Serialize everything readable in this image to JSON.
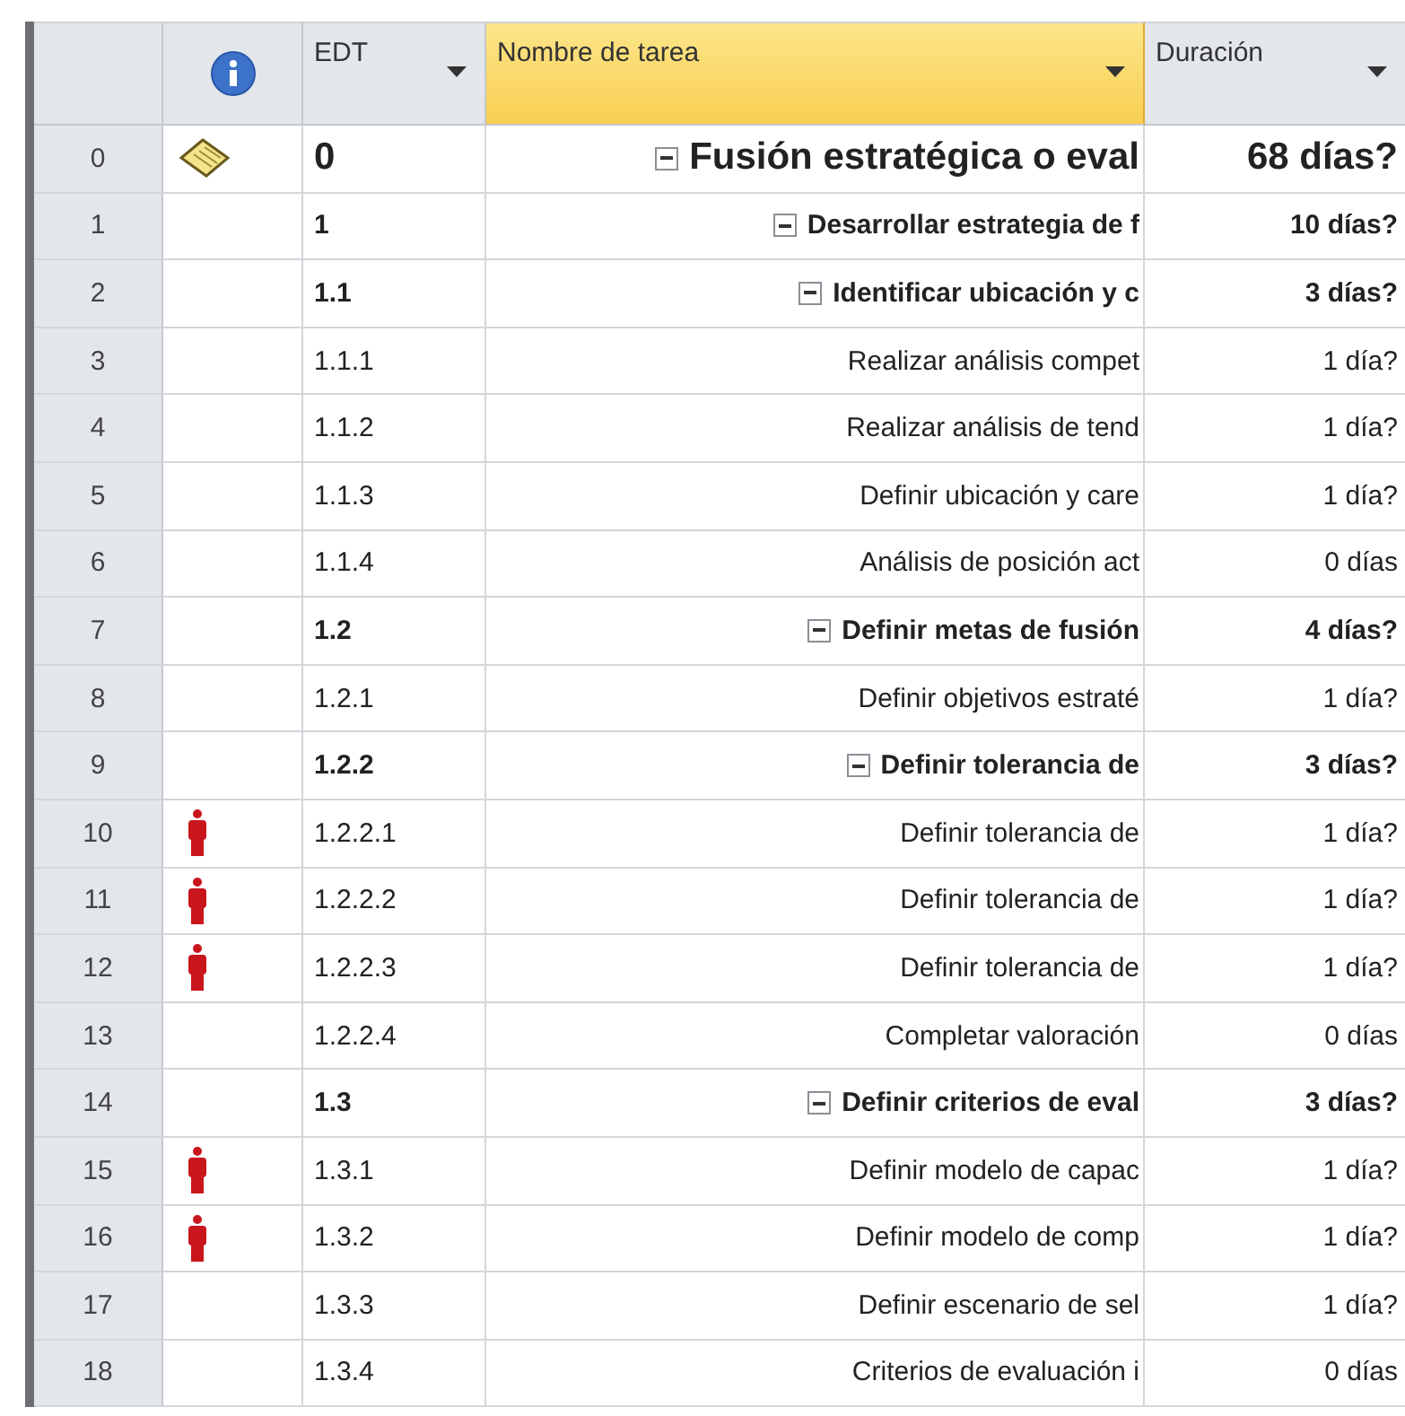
{
  "columns": [
    {
      "label": "EDT",
      "selected": false
    },
    {
      "label": "Nombre de tarea",
      "selected": true
    },
    {
      "label": "Duración",
      "selected": false
    }
  ],
  "tasks": [
    {
      "id": "0",
      "wbs": "0",
      "name": "Fusión estratégica o eval",
      "duration": "68 días?",
      "kind": "note",
      "expanded": true,
      "children": [
        {
          "id": "1",
          "wbs": "1",
          "name": "Desarrollar estrategia de f",
          "duration": "10 días?",
          "expanded": true,
          "children": [
            {
              "id": "2",
              "wbs": "1.1",
              "name": "Identificar ubicación y c",
              "duration": "3 días?",
              "expanded": true,
              "children": [
                {
                  "id": "3",
                  "wbs": "1.1.1",
                  "name": "Realizar análisis compet",
                  "duration": "1 día?"
                },
                {
                  "id": "4",
                  "wbs": "1.1.2",
                  "name": "Realizar análisis de tend",
                  "duration": "1 día?"
                },
                {
                  "id": "5",
                  "wbs": "1.1.3",
                  "name": "Definir ubicación y care",
                  "duration": "1 día?"
                },
                {
                  "id": "6",
                  "wbs": "1.1.4",
                  "name": "Análisis de posición act",
                  "duration": "0 días"
                }
              ]
            },
            {
              "id": "7",
              "wbs": "1.2",
              "name": "Definir metas de fusión",
              "duration": "4 días?",
              "expanded": true,
              "children": [
                {
                  "id": "8",
                  "wbs": "1.2.1",
                  "name": "Definir objetivos estraté",
                  "duration": "1 día?"
                },
                {
                  "id": "9",
                  "wbs": "1.2.2",
                  "name": "Definir tolerancia de",
                  "duration": "3 días?",
                  "expanded": true,
                  "children": [
                    {
                      "id": "10",
                      "wbs": "1.2.2.1",
                      "name": "Definir tolerancia de",
                      "duration": "1 día?",
                      "kind": "person"
                    },
                    {
                      "id": "11",
                      "wbs": "1.2.2.2",
                      "name": "Definir tolerancia de",
                      "duration": "1 día?",
                      "kind": "person"
                    },
                    {
                      "id": "12",
                      "wbs": "1.2.2.3",
                      "name": "Definir tolerancia de",
                      "duration": "1 día?",
                      "kind": "person"
                    },
                    {
                      "id": "13",
                      "wbs": "1.2.2.4",
                      "name": "Completar valoración",
                      "duration": "0 días"
                    }
                  ]
                }
              ]
            },
            {
              "id": "14",
              "wbs": "1.3",
              "name": "Definir criterios de eval",
              "duration": "3 días?",
              "expanded": true,
              "children": [
                {
                  "id": "15",
                  "wbs": "1.3.1",
                  "name": "Definir modelo de capac",
                  "duration": "1 día?",
                  "kind": "person"
                },
                {
                  "id": "16",
                  "wbs": "1.3.2",
                  "name": "Definir modelo de comp",
                  "duration": "1 día?",
                  "kind": "person"
                },
                {
                  "id": "17",
                  "wbs": "1.3.3",
                  "name": "Definir escenario de sel",
                  "duration": "1 día?"
                },
                {
                  "id": "18",
                  "wbs": "1.3.4",
                  "name": "Criterios de evaluación i",
                  "duration": "0 días"
                }
              ]
            }
          ]
        }
      ]
    }
  ]
}
